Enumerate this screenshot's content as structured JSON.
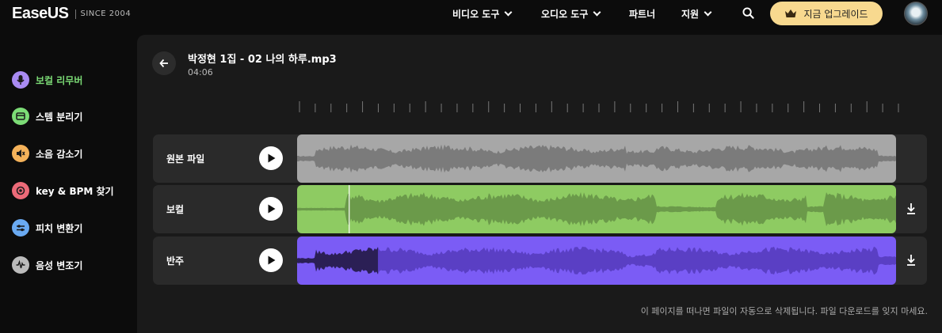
{
  "header": {
    "logo_text": "EaseUS",
    "logo_since": "SINCE 2004",
    "nav": [
      {
        "label": "비디오 도구",
        "has_dropdown": true
      },
      {
        "label": "오디오 도구",
        "has_dropdown": true
      },
      {
        "label": "파트너",
        "has_dropdown": false
      },
      {
        "label": "지원",
        "has_dropdown": true
      }
    ],
    "upgrade_label": "지금 업그레이드",
    "icons": {
      "search": "search-icon",
      "crown": "crown-icon",
      "avatar": "avatar"
    }
  },
  "sidebar": {
    "items": [
      {
        "label": "보컬 리무버",
        "icon": "mic-icon",
        "color": "#a98bf2",
        "active": true
      },
      {
        "label": "스템 분리기",
        "icon": "stem-icon",
        "color": "#7cdc76",
        "active": false
      },
      {
        "label": "소음 감소기",
        "icon": "speaker-icon",
        "color": "#f4b25a",
        "active": false
      },
      {
        "label": "key & BPM 찾기",
        "icon": "target-icon",
        "color": "#ec6a78",
        "active": false
      },
      {
        "label": "피치 변환기",
        "icon": "sliders-icon",
        "color": "#6aaaf2",
        "active": false
      },
      {
        "label": "음성 변조기",
        "icon": "wave-icon",
        "color": "#bbbbbb",
        "active": false
      }
    ]
  },
  "file": {
    "title": "박정현 1집 - 02 나의 하루.mp3",
    "duration": "04:06"
  },
  "tracks": [
    {
      "label": "원본 파일",
      "color": "#a7a7a7",
      "wave_color": "#7b7b7b",
      "downloadable": false,
      "playhead": null,
      "played": 0
    },
    {
      "label": "보컬",
      "color": "#8ecb62",
      "wave_color": "#6b9a4a",
      "downloadable": true,
      "playhead": 0.087,
      "played": 0
    },
    {
      "label": "반주",
      "color": "#7b5cf5",
      "wave_color": "#5a3fc4",
      "downloadable": true,
      "playhead": null,
      "played": 0.135
    }
  ],
  "footer_note": "이 페이지를 떠나면 파일이 자동으로 삭제됩니다. 파일 다운로드를 잊지 마세요.",
  "colors": {
    "accent": "#7cdc76",
    "upgrade_bg": "#f8d98f"
  }
}
